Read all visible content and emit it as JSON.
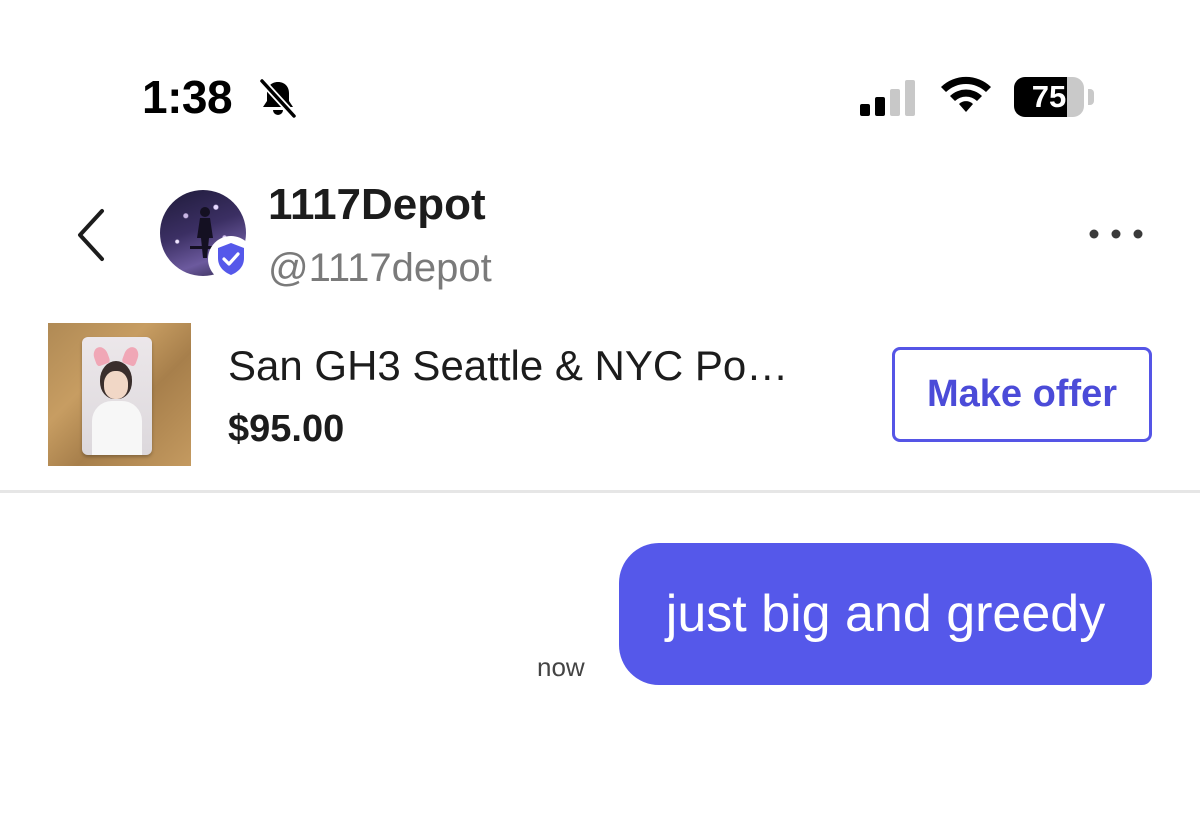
{
  "status_bar": {
    "time": "1:38",
    "battery_percent": "75",
    "battery_level": 0.75,
    "icons": [
      "bell-slash-icon",
      "cellular-signal-icon",
      "wifi-icon",
      "battery-icon"
    ]
  },
  "header": {
    "display_name": "1117Depot",
    "handle": "@1117depot",
    "verified": true,
    "icons": [
      "chevron-left-icon",
      "verified-shield-icon",
      "more-horizontal-icon"
    ]
  },
  "listing": {
    "title": "San GH3 Seattle & NYC Po…",
    "price": "$95.00",
    "offer_button_label": "Make offer"
  },
  "messages": [
    {
      "text": "just big and greedy",
      "timestamp": "now",
      "from_me": true
    }
  ],
  "colors": {
    "accent": "#5558ea",
    "button_text": "#4b4bd8",
    "handle_gray": "#7a7a7a",
    "divider": "#e6e6e6"
  }
}
